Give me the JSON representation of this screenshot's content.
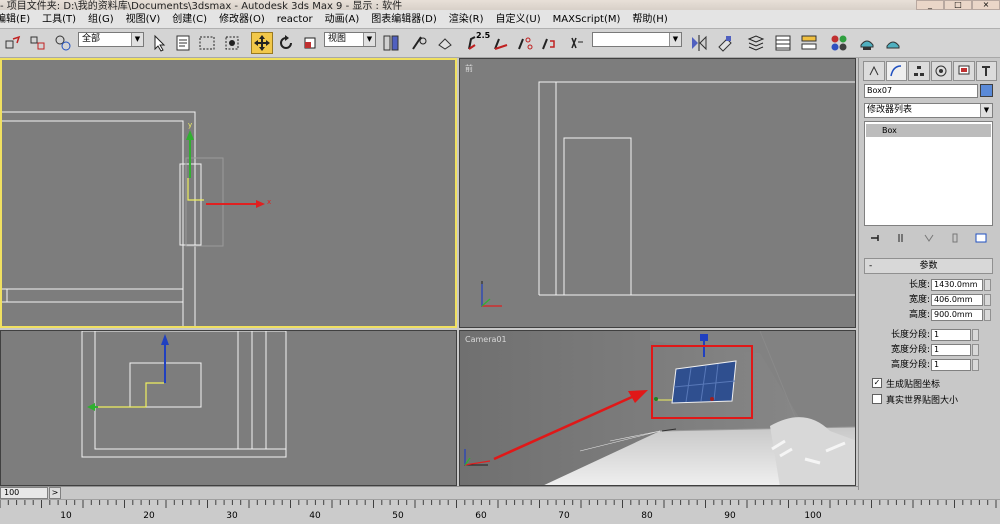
{
  "window": {
    "title": "- 项目文件夹: D:\\我的资料库\\Documents\\3dsmax    - Autodesk 3ds Max 9    - 显示 : 软件",
    "controls": [
      "_",
      "□",
      "×"
    ]
  },
  "menu": [
    "编辑(E)",
    "工具(T)",
    "组(G)",
    "视图(V)",
    "创建(C)",
    "修改器(O)",
    "reactor",
    "动画(A)",
    "图表编辑器(D)",
    "渲染(R)",
    "自定义(U)",
    "MAXScript(M)",
    "帮助(H)"
  ],
  "toolbar": {
    "selection_filter": "全部",
    "reference_coord": "视图",
    "snap_value": "2.5",
    "named_selection": ""
  },
  "viewports": {
    "top_left_label": "",
    "front_label": "前",
    "left_label": "",
    "camera_label": "Camera01"
  },
  "axis": {
    "x": "x",
    "y": "y"
  },
  "command_panel": {
    "object_name": "Box07",
    "object_color": "#5a8ad8",
    "modifier_list": "修改器列表",
    "stack_item": "Box",
    "rollout_title": "参数",
    "params": [
      {
        "label": "长度:",
        "value": "1430.0mm"
      },
      {
        "label": "宽度:",
        "value": "406.0mm"
      },
      {
        "label": "高度:",
        "value": "900.0mm"
      }
    ],
    "segments": [
      {
        "label": "长度分段:",
        "value": "1"
      },
      {
        "label": "宽度分段:",
        "value": "1"
      },
      {
        "label": "高度分段:",
        "value": "1"
      }
    ],
    "options": [
      {
        "label": "生成贴图坐标",
        "checked": true
      },
      {
        "label": "真实世界贴图大小",
        "checked": false
      }
    ]
  },
  "timeline": {
    "frame_display": "100",
    "next_label": ">",
    "ruler_labels": [
      "10",
      "20",
      "30",
      "40",
      "50",
      "60",
      "70",
      "80",
      "90",
      "100"
    ]
  },
  "colors": {
    "viewport_bg": "#7d7d7d",
    "active_border": "#f0e060",
    "highlight_box": "#e01818",
    "arrow": "#e01818",
    "selected_object": "#2f4f8f"
  }
}
